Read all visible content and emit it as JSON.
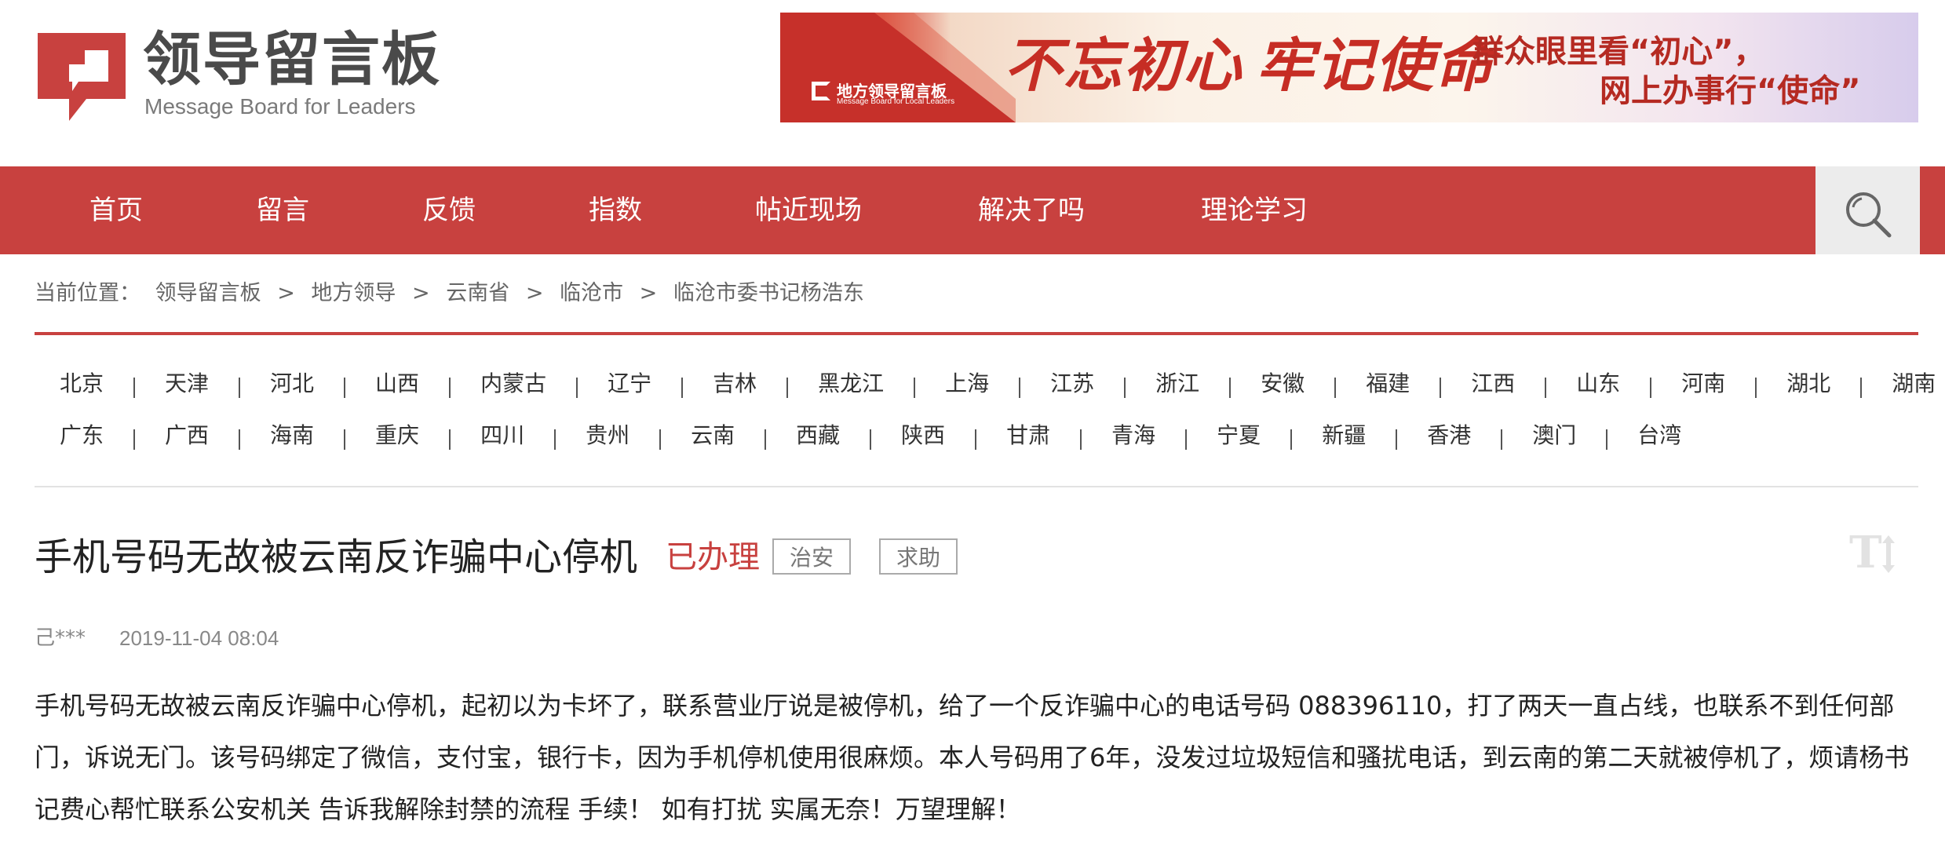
{
  "site": {
    "name_cn": "领导留言板",
    "name_en": "Message Board for Leaders",
    "brand_color": "#c8413f"
  },
  "banner": {
    "logo_cn": "地方领导留言板",
    "logo_en": "Message Board for Local Leaders",
    "slogan_part1": "不忘初心",
    "slogan_part2": "牢记使命",
    "line1": "群众眼里看“初心”，",
    "line2": "网上办事行“使命”"
  },
  "nav": {
    "items": [
      {
        "label": "首页"
      },
      {
        "label": "留言"
      },
      {
        "label": "反馈"
      },
      {
        "label": "指数"
      },
      {
        "label": "帖近现场"
      },
      {
        "label": "解决了吗"
      },
      {
        "label": "理论学习"
      }
    ],
    "search_icon": "search-icon"
  },
  "breadcrumb": {
    "prefix": "当前位置：",
    "separator": ">",
    "items": [
      "领导留言板",
      "地方领导",
      "云南省",
      "临沧市",
      "临沧市委书记杨浩东"
    ]
  },
  "regions": {
    "row1": [
      "北京",
      "天津",
      "河北",
      "山西",
      "内蒙古",
      "辽宁",
      "吉林",
      "黑龙江",
      "上海",
      "江苏",
      "浙江",
      "安徽",
      "福建",
      "江西",
      "山东",
      "河南",
      "湖北",
      "湖南"
    ],
    "row2": [
      "广东",
      "广西",
      "海南",
      "重庆",
      "四川",
      "贵州",
      "云南",
      "西藏",
      "陕西",
      "甘肃",
      "青海",
      "宁夏",
      "新疆",
      "香港",
      "澳门",
      "台湾"
    ]
  },
  "post": {
    "title": "手机号码无故被云南反诈骗中心停机",
    "status": "已办理",
    "tags": [
      "治安",
      "求助"
    ],
    "font_toggle_icon": "font-size-toggle-icon",
    "author": "己***",
    "date": "2019-11-04 08:04",
    "body_lines": [
      "手机号码无故被云南反诈骗中心停机，起初以为卡坏了，联系营业厅说是被停机，给了一个反诈骗中心的电话号码  088396110，打了两天一直占线，也联系不到任何部",
      "门，诉说无门。该号码绑定了微信，支付宝，银行卡，因为手机停机使用很麻烦。本人号码用了6年，没发过垃圾短信和骚扰电话，到云南的第二天就被停机了，烦请杨书",
      "记费心帮忙联系公安机关 告诉我解除封禁的流程 手续！ 如有打扰 实属无奈！万望理解！"
    ]
  }
}
